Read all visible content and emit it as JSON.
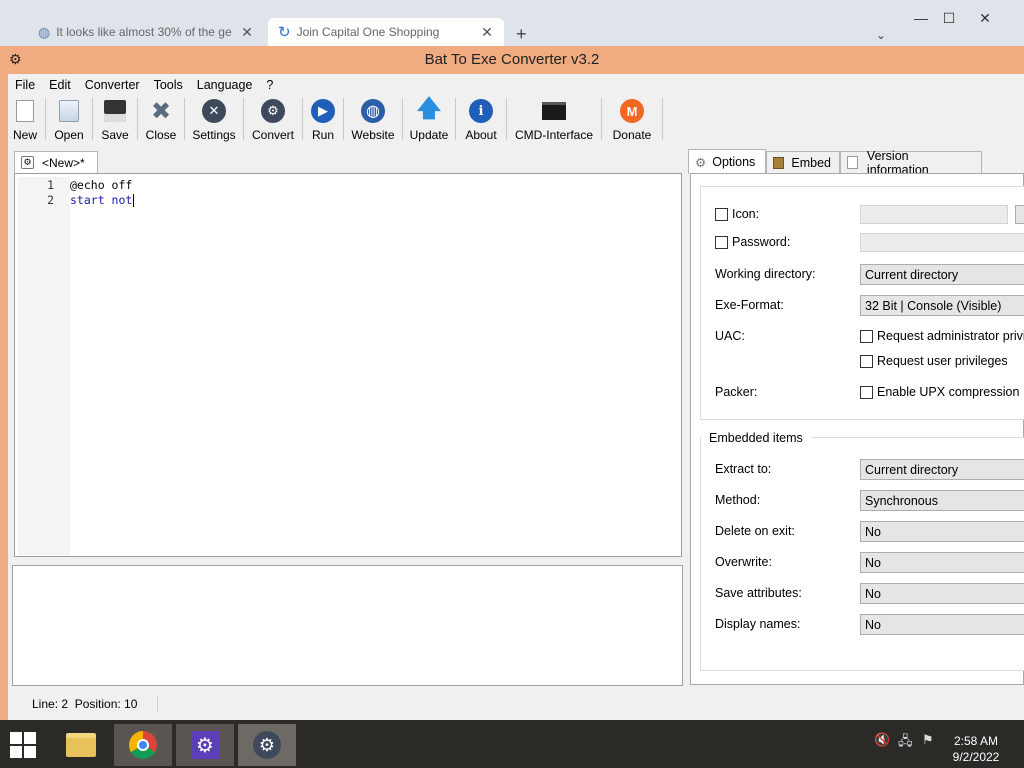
{
  "browser": {
    "tabs": [
      {
        "title": "It looks like almost 30% of the ge",
        "close": "✕"
      },
      {
        "title": "Join Capital One Shopping",
        "close": "✕"
      }
    ],
    "new_tab": "+",
    "window_controls": {
      "minimize": "—",
      "maximize": "☐",
      "close": "✕"
    },
    "dropdown": "⌄"
  },
  "app": {
    "title": "Bat To Exe Converter v3.2",
    "icon": "gear-icon"
  },
  "menu": [
    "File",
    "Edit",
    "Converter",
    "Tools",
    "Language",
    "?"
  ],
  "toolbar": [
    {
      "label": "New",
      "icon": "new-file-icon"
    },
    {
      "label": "Open",
      "icon": "open-folder-icon"
    },
    {
      "label": "Save",
      "icon": "floppy-icon"
    },
    {
      "label": "Close",
      "icon": "close-x-icon"
    },
    {
      "label": "Settings",
      "icon": "settings-icon"
    },
    {
      "label": "Convert",
      "icon": "convert-gear-icon"
    },
    {
      "label": "Run",
      "icon": "play-icon"
    },
    {
      "label": "Website",
      "icon": "globe-icon"
    },
    {
      "label": "Update",
      "icon": "up-arrow-icon"
    },
    {
      "label": "About",
      "icon": "info-icon"
    },
    {
      "label": "CMD-Interface",
      "icon": "terminal-icon"
    },
    {
      "label": "Donate",
      "icon": "monero-icon"
    }
  ],
  "editor": {
    "tab_label": "<New>*",
    "lines": [
      {
        "num": "1",
        "text": "@echo off"
      },
      {
        "num": "2",
        "text": "start not"
      }
    ]
  },
  "status": {
    "text": "Line: 2  Position: 10"
  },
  "right_tabs": [
    "Options",
    "Embed",
    "Version information"
  ],
  "options": {
    "icon_label": "Icon:",
    "password_label": "Password:",
    "working_directory_label": "Working directory:",
    "working_directory_value": "Current directory",
    "exe_format_label": "Exe-Format:",
    "exe_format_value": "32 Bit | Console (Visible)",
    "uac_label": "UAC:",
    "uac_admin": "Request administrator privileges",
    "uac_user": "Request user privileges",
    "packer_label": "Packer:",
    "packer_upx": "Enable UPX compression"
  },
  "embedded": {
    "group_title": "Embedded items",
    "extract_to_label": "Extract to:",
    "extract_to_value": "Current directory",
    "method_label": "Method:",
    "method_value": "Synchronous",
    "delete_on_exit_label": "Delete on exit:",
    "delete_on_exit_value": "No",
    "overwrite_label": "Overwrite:",
    "overwrite_value": "No",
    "save_attributes_label": "Save attributes:",
    "save_attributes_value": "No",
    "display_names_label": "Display names:",
    "display_names_value": "No"
  },
  "taskbar": {
    "time": "2:58 AM",
    "date": "9/2/2022"
  },
  "colors": {
    "frame": "#f0ab80",
    "taskbar": "#2c2a27",
    "keyword_blue": "#1a1aa8"
  }
}
